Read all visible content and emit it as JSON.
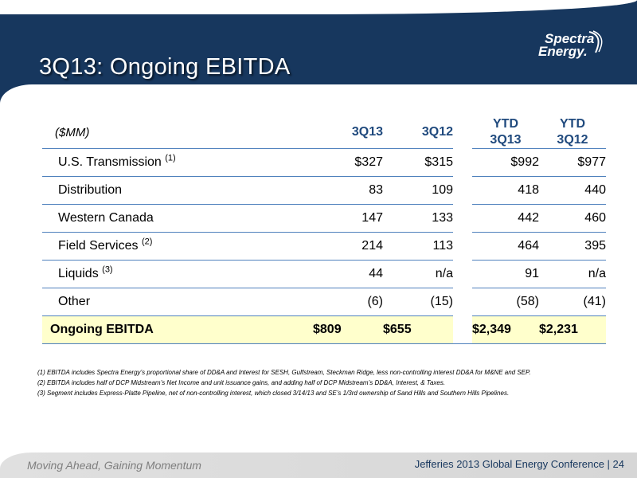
{
  "slide": {
    "title": "3Q13: Ongoing EBITDA",
    "logo_line1": "Spectra",
    "logo_line2": "Energy.",
    "brand_color": "#17375e",
    "accent_color": "#1f497d",
    "highlight_color": "#ffffcc"
  },
  "table": {
    "unit_label": "($MM)",
    "columns": [
      "3Q13",
      "3Q12",
      "YTD 3Q13",
      "YTD 3Q12"
    ],
    "ytd_prefix": "YTD",
    "ytd_cols": [
      "3Q13",
      "3Q12"
    ],
    "rows": [
      {
        "label": "U.S. Transmission",
        "note": "(1)",
        "values": [
          "$327",
          "$315",
          "$992",
          "$977"
        ]
      },
      {
        "label": "Distribution",
        "note": "",
        "values": [
          "83",
          "109",
          "418",
          "440"
        ]
      },
      {
        "label": "Western Canada",
        "note": "",
        "values": [
          "147",
          "133",
          "442",
          "460"
        ]
      },
      {
        "label": "Field Services",
        "note": "(2)",
        "values": [
          "214",
          "113",
          "464",
          "395"
        ]
      },
      {
        "label": "Liquids",
        "note": "(3)",
        "values": [
          "44",
          "n/a",
          "91",
          "n/a"
        ]
      },
      {
        "label": "Other",
        "note": "",
        "values": [
          "(6)",
          "(15)",
          "(58)",
          "(41)"
        ]
      }
    ],
    "total": {
      "label": "Ongoing EBITDA",
      "values": [
        "$809",
        "$655",
        "$2,349",
        "$2,231"
      ]
    }
  },
  "footnotes": [
    "(1)  EBITDA includes Spectra Energy’s proportional share of DD&A and Interest for SESH, Gulfstream, Steckman Ridge, less non-controlling interest DD&A for M&NE and SEP.",
    "(2)  EBITDA includes half of DCP Midstream’s Net Income and unit issuance gains, and adding half of DCP Midstream’s DD&A, Interest, & Taxes.",
    "(3)  Segment includes Express-Platte Pipeline, net of non-controlling interest, which closed 3/14/13 and SE’s 1/3rd ownership of Sand Hills and Southern Hills Pipelines."
  ],
  "footer": {
    "tagline": "Moving Ahead, Gaining Momentum",
    "conference": "Jefferies 2013 Global Energy Conference | 24"
  }
}
